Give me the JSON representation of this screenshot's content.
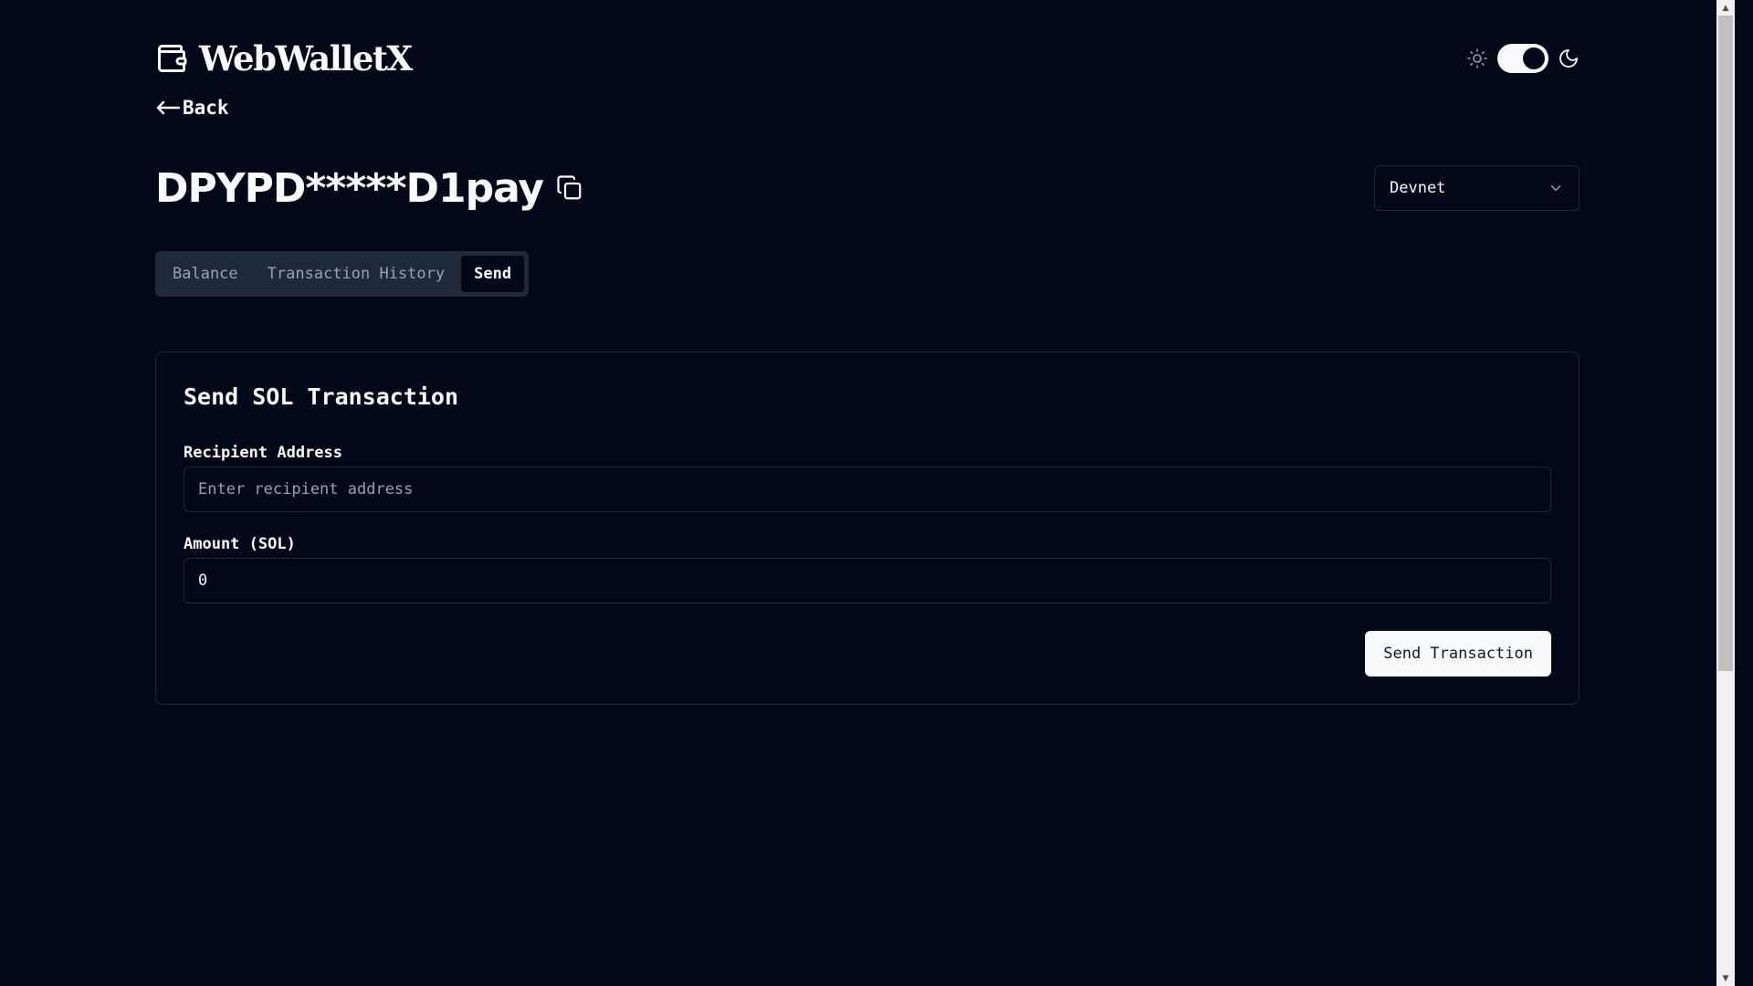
{
  "app": {
    "name": "WebWalletX"
  },
  "theme": {
    "mode": "dark",
    "sun_icon": "sun-icon",
    "moon_icon": "moon-icon"
  },
  "nav": {
    "back_label": "Back",
    "back_icon": "arrow-left-icon"
  },
  "wallet": {
    "address": "DPYPD*****D1pay",
    "copy_icon": "copy-icon"
  },
  "network": {
    "selected": "Devnet",
    "icon": "chevron-down-icon"
  },
  "tabs": [
    {
      "label": "Balance",
      "active": false
    },
    {
      "label": "Transaction History",
      "active": false
    },
    {
      "label": "Send",
      "active": true
    }
  ],
  "send_form": {
    "title": "Send SOL Transaction",
    "recipient": {
      "label": "Recipient Address",
      "placeholder": "Enter recipient address",
      "value": ""
    },
    "amount": {
      "label": "Amount (SOL)",
      "value": "0"
    },
    "submit_label": "Send Transaction"
  },
  "colors": {
    "background": "#020817",
    "foreground": "#f8fafc",
    "border": "#1e293b",
    "muted": "#94a3b8"
  }
}
